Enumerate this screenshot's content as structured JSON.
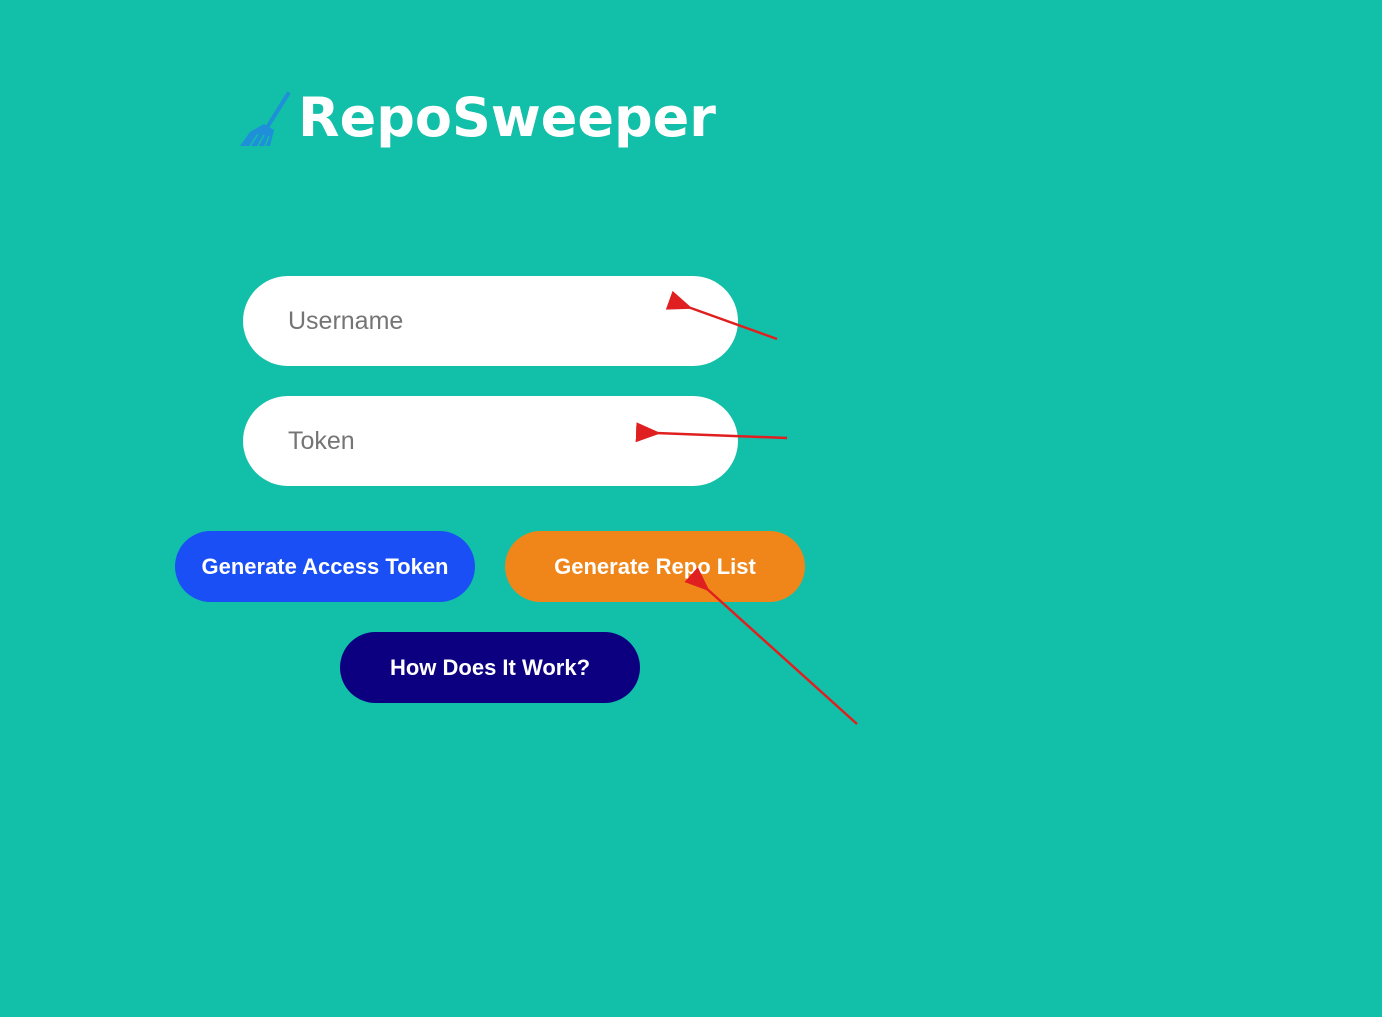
{
  "app": {
    "logo_text": "RepoSweeper",
    "logo_icon": "broom-icon"
  },
  "form": {
    "username_placeholder": "Username",
    "username_value": "",
    "token_placeholder": "Token",
    "token_value": ""
  },
  "buttons": {
    "generate_access_token": "Generate Access Token",
    "generate_repo_list": "Generate Repo List",
    "how_does_it_work": "How Does It Work?"
  },
  "colors": {
    "background": "#12bfa8",
    "access_token_button": "#1a4ff5",
    "repo_list_button": "#f0861a",
    "how_button": "#0c0080",
    "annotation_arrow": "#e02020",
    "broom_icon": "#1e8fd8"
  },
  "annotations": {
    "arrow_icon": "red-arrow-icon"
  }
}
